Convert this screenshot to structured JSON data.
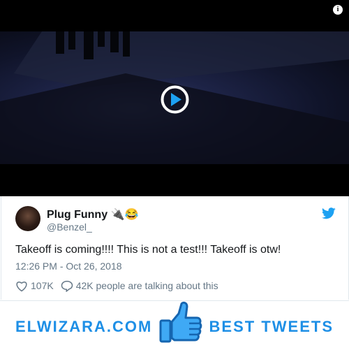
{
  "tweet": {
    "display_name": "Plug Funny 🔌😂",
    "handle": "@Benzel_",
    "text": "Takeoff is coming!!!! This is not a test!!! Takeoff is otw!",
    "timestamp": "12:26 PM - Oct 26, 2018",
    "like_count": "107K",
    "talking_text": "42K people are talking about this"
  },
  "video": {
    "info_symbol": "i"
  },
  "banner": {
    "left_text": "ELWIZARA.COM",
    "right_text": "BEST TWEETS"
  },
  "colors": {
    "twitter_blue": "#1da1f2",
    "banner_blue": "#1e8fe6",
    "text_dark": "#14171a",
    "text_muted": "#657786"
  },
  "icons": [
    "info-icon",
    "play-icon",
    "twitter-bird-icon",
    "heart-icon",
    "speech-bubble-icon",
    "thumbs-up-icon"
  ]
}
